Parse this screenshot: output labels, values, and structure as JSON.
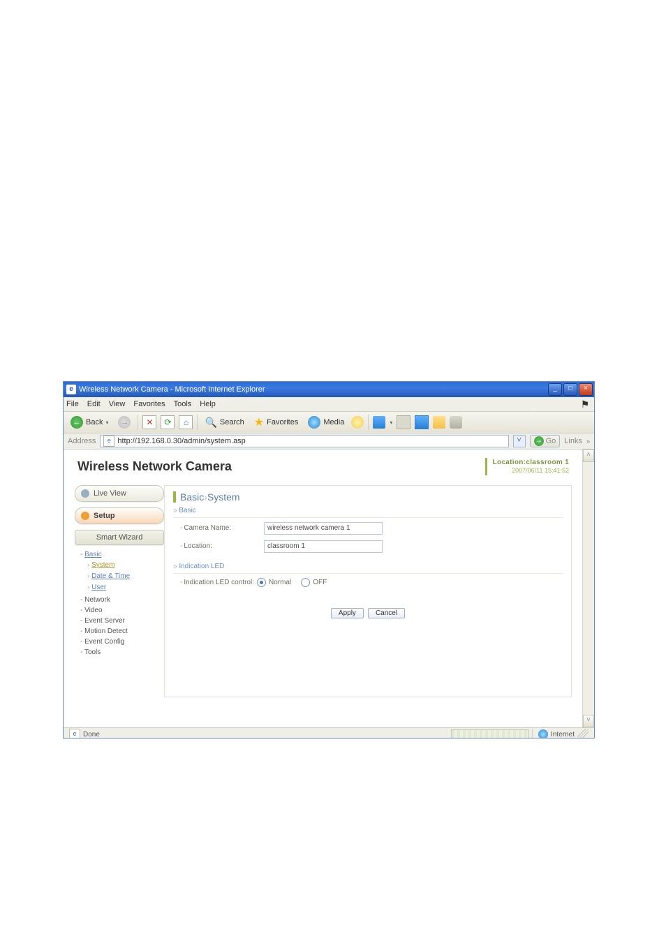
{
  "window": {
    "title": "Wireless Network Camera - Microsoft Internet Explorer"
  },
  "menu": {
    "file": "File",
    "edit": "Edit",
    "view": "View",
    "favorites": "Favorites",
    "tools": "Tools",
    "help": "Help"
  },
  "toolbar": {
    "back": "Back",
    "search": "Search",
    "favorites": "Favorites",
    "media": "Media"
  },
  "addressbar": {
    "label": "Address",
    "url": "http://192.168.0.30/admin/system.asp",
    "go": "Go",
    "links": "Links"
  },
  "header": {
    "product": "Wireless Network Camera",
    "location_label": "Location:",
    "location_value": "classroom 1",
    "timestamp": "2007/06/11 15:41:52"
  },
  "nav": {
    "live_view": "Live View",
    "setup": "Setup",
    "smart_wizard": "Smart Wizard",
    "basic": "Basic",
    "system": "System",
    "date_time": "Date & Time",
    "user": "User",
    "network": "Network",
    "video": "Video",
    "event_server": "Event Server",
    "motion_detect": "Motion Detect",
    "event_config": "Event Config",
    "tools": "Tools"
  },
  "panel": {
    "title_main": "Basic",
    "title_sub": "System",
    "section_basic": "Basic",
    "camera_name_label": "Camera Name:",
    "camera_name_value": "wireless network camera 1",
    "location_label": "Location:",
    "location_value": "classroom 1",
    "section_led": "Indication LED",
    "led_label": "Indication LED control:",
    "led_normal": "Normal",
    "led_off": "OFF",
    "apply": "Apply",
    "cancel": "Cancel"
  },
  "status": {
    "done": "Done",
    "zone": "Internet"
  }
}
